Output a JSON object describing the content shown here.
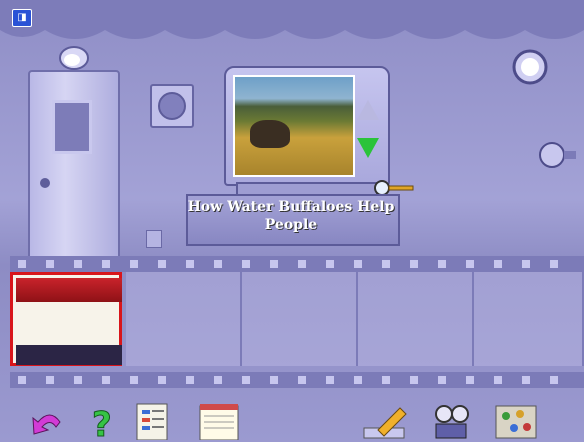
{
  "viewer": {
    "caption": "How Water Buffaloes Help People",
    "photo_icon": "water-buffalo-photo"
  },
  "app_badge_icon": "app-logo-icon",
  "colors": {
    "background": "#9493c8",
    "selected_frame_border": "#d8151b",
    "scroll_down_arrow": "#2bc33a",
    "scroll_up_arrow": "#b9b8e0"
  },
  "film_frames": [
    {
      "name": "frame-1",
      "selected": true,
      "content": "stage-scene"
    },
    {
      "name": "frame-2",
      "selected": false,
      "content": "empty"
    },
    {
      "name": "frame-3",
      "selected": false,
      "content": "empty"
    },
    {
      "name": "frame-4",
      "selected": false,
      "content": "empty"
    },
    {
      "name": "frame-5",
      "selected": false,
      "content": "empty"
    }
  ],
  "toolbar": [
    {
      "name": "back-arrow-icon"
    },
    {
      "name": "help-question-icon"
    },
    {
      "name": "notes-list-icon"
    },
    {
      "name": "notepad-icon"
    },
    {
      "name": "pencil-edit-icon"
    },
    {
      "name": "movie-projector-icon"
    },
    {
      "name": "gallery-icon"
    }
  ]
}
